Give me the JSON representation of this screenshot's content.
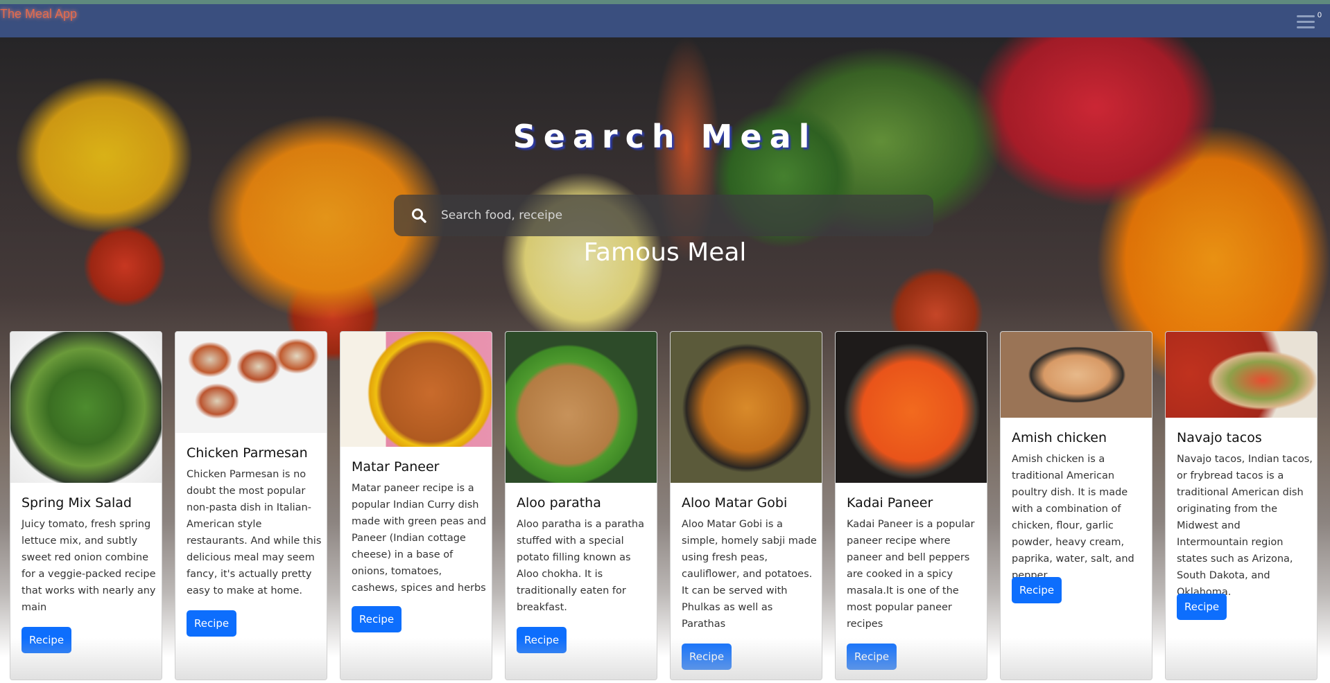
{
  "navbar": {
    "brand": "The Meal App",
    "cart_count": "0",
    "menu_icon": "hamburger-menu-icon"
  },
  "hero": {
    "title": "Search Meal",
    "search_placeholder": "Search food, receipe",
    "search_value": "",
    "section_title": "Famous Meal"
  },
  "cards": [
    {
      "title": "Spring Mix Salad",
      "description": "Juicy tomato, fresh spring lettuce mix, and subtly sweet red onion combine for a veggie-packed recipe that works with nearly any main",
      "button": "Recipe"
    },
    {
      "title": "Chicken Parmesan",
      "description": "Chicken Parmesan is no doubt the most popular non-pasta dish in Italian-American style restaurants. And while this delicious meal may seem fancy, it's actually pretty easy to make at home.",
      "button": "Recipe"
    },
    {
      "title": "Matar Paneer",
      "description": "Matar paneer recipe is a popular Indian Curry dish made with green peas and Paneer (Indian cottage cheese) in a base of onions, tomatoes, cashews, spices and herbs",
      "button": "Recipe"
    },
    {
      "title": "Aloo paratha",
      "description": "Aloo paratha is a paratha stuffed with a special potato filling known as Aloo chokha. It is traditionally eaten for breakfast.",
      "button": "Recipe"
    },
    {
      "title": "Aloo Matar Gobi",
      "description": "Aloo Matar Gobi is a simple, homely sabji made using fresh peas, cauliflower, and potatoes. It can be served with Phulkas as well as Parathas",
      "button": "Recipe"
    },
    {
      "title": "Kadai Paneer",
      "description": "Kadai Paneer is a popular paneer recipe where paneer and bell peppers are cooked in a spicy masala.It is one of the most popular paneer recipes",
      "button": "Recipe"
    },
    {
      "title": "Amish chicken",
      "description": "Amish chicken is a traditional American poultry dish. It is made with a combination of chicken, flour, garlic powder, heavy cream, paprika, water, salt, and pepper.",
      "button": "Recipe"
    },
    {
      "title": "Navajo tacos",
      "description": "Navajo tacos, Indian tacos, or frybread tacos is a traditional American dish originating from the Midwest and Intermountain region states such as Arizona, South Dakota, and Oklahoma.",
      "button": "Recipe"
    }
  ],
  "colors": {
    "navbar_bg": "#3a4f7f",
    "brand": "#e46b4d",
    "button": "#0d6efd",
    "title_shadow": "#2c3aa5"
  }
}
